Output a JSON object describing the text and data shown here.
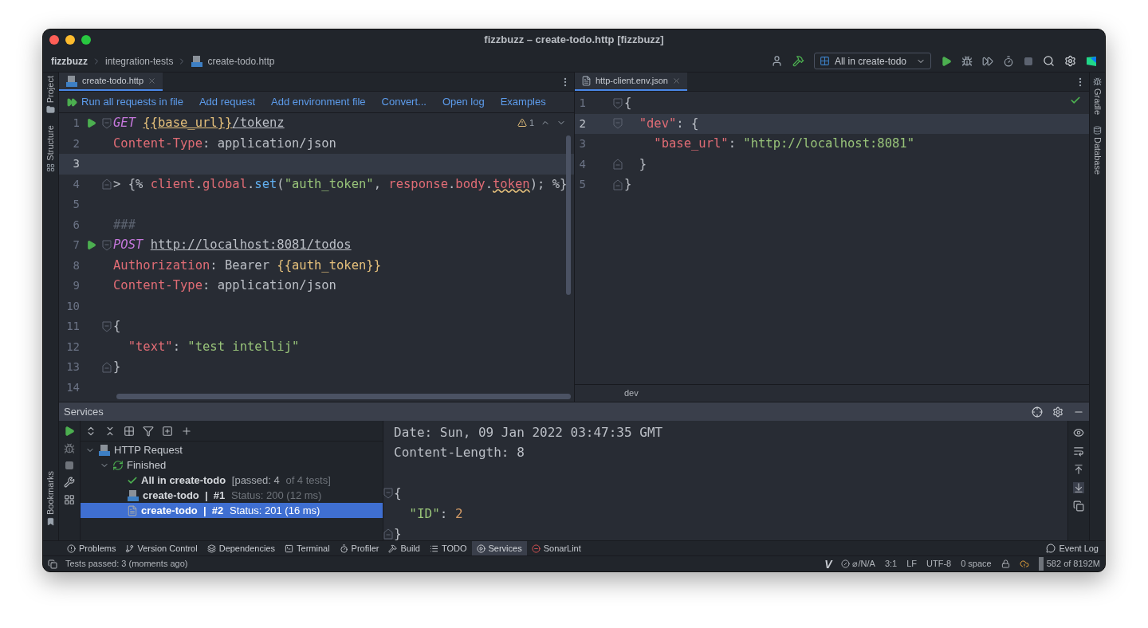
{
  "window": {
    "title": "fizzbuzz – create-todo.http [fizzbuzz]"
  },
  "breadcrumbs": [
    "fizzbuzz",
    "integration-tests",
    "create-todo.http"
  ],
  "run_config": "All in create-todo",
  "left_stripe": {
    "top": [
      "Project",
      "Structure"
    ],
    "bottom": [
      "Bookmarks"
    ]
  },
  "right_stripe": [
    "Gradle",
    "Database"
  ],
  "left_editor": {
    "tab": {
      "label": "create-todo.http",
      "selected": true
    },
    "actions": [
      "Run all requests in file",
      "Add request",
      "Add environment file",
      "Convert...",
      "Open log",
      "Examples"
    ],
    "warnings": "1",
    "lines": [
      {
        "n": "1",
        "run": true,
        "fold_open": true,
        "fold_close": false,
        "current": false,
        "tokens": [
          {
            "kind": "method",
            "text": "GET "
          },
          {
            "kind": "varurl",
            "text": "{{base_url}}"
          },
          {
            "kind": "url",
            "text": "/tokenz"
          }
        ]
      },
      {
        "n": "2",
        "run": false,
        "fold_open": false,
        "fold_close": false,
        "current": false,
        "tokens": [
          {
            "kind": "header",
            "text": "Content-Type"
          },
          {
            "kind": "plain",
            "text": ": application/json"
          }
        ]
      },
      {
        "n": "3",
        "run": false,
        "fold_open": false,
        "fold_close": false,
        "current": true
      },
      {
        "n": "4",
        "run": false,
        "fold_open": false,
        "fold_close": true,
        "current": false,
        "tokens": [
          {
            "kind": "plain",
            "text": "> {% "
          },
          {
            "kind": "ident",
            "text": "client"
          },
          {
            "kind": "plain",
            "text": "."
          },
          {
            "kind": "ident",
            "text": "global"
          },
          {
            "kind": "plain",
            "text": "."
          },
          {
            "kind": "fn",
            "text": "set"
          },
          {
            "kind": "plain",
            "text": "("
          },
          {
            "kind": "string",
            "text": "\"auth_token\""
          },
          {
            "kind": "plain",
            "text": ", "
          },
          {
            "kind": "ident",
            "text": "response"
          },
          {
            "kind": "plain",
            "text": "."
          },
          {
            "kind": "ident",
            "text": "body"
          },
          {
            "kind": "plain",
            "text": "."
          },
          {
            "kind": "warn",
            "text": "token"
          },
          {
            "kind": "plain",
            "text": "); %}"
          }
        ]
      },
      {
        "n": "5",
        "run": false,
        "fold_open": false,
        "fold_close": false,
        "current": false
      },
      {
        "n": "6",
        "run": false,
        "fold_open": false,
        "fold_close": false,
        "current": false,
        "tokens": [
          {
            "kind": "comment",
            "text": "###"
          }
        ]
      },
      {
        "n": "7",
        "run": true,
        "fold_open": true,
        "fold_close": false,
        "current": false,
        "tokens": [
          {
            "kind": "method",
            "text": "POST "
          },
          {
            "kind": "url",
            "text": "http://localhost:8081/todos"
          }
        ]
      },
      {
        "n": "8",
        "run": false,
        "fold_open": false,
        "fold_close": false,
        "current": false,
        "tokens": [
          {
            "kind": "header",
            "text": "Authorization"
          },
          {
            "kind": "plain",
            "text": ": Bearer "
          },
          {
            "kind": "var",
            "text": "{{auth_token}}"
          }
        ]
      },
      {
        "n": "9",
        "run": false,
        "fold_open": false,
        "fold_close": false,
        "current": false,
        "tokens": [
          {
            "kind": "header",
            "text": "Content-Type"
          },
          {
            "kind": "plain",
            "text": ": application/json"
          }
        ]
      },
      {
        "n": "10",
        "run": false,
        "fold_open": false,
        "fold_close": false,
        "current": false
      },
      {
        "n": "11",
        "run": false,
        "fold_open": true,
        "fold_close": false,
        "current": false,
        "tokens": [
          {
            "kind": "plain",
            "text": "{"
          }
        ]
      },
      {
        "n": "12",
        "run": false,
        "fold_open": false,
        "fold_close": false,
        "current": false,
        "tokens": [
          {
            "kind": "key",
            "text": "  \"text\""
          },
          {
            "kind": "plain",
            "text": ": "
          },
          {
            "kind": "string",
            "text": "\"test intellij\""
          }
        ]
      },
      {
        "n": "13",
        "run": false,
        "fold_open": false,
        "fold_close": true,
        "current": false,
        "tokens": [
          {
            "kind": "plain",
            "text": "}"
          }
        ]
      },
      {
        "n": "14",
        "run": false,
        "fold_open": false,
        "fold_close": false,
        "current": false
      }
    ]
  },
  "right_editor": {
    "tab": {
      "label": "http-client.env.json",
      "selected": true
    },
    "lines": [
      {
        "n": "1",
        "fold_open": true,
        "fold_close": false,
        "current": false,
        "tokens": [
          {
            "kind": "plain",
            "text": "{"
          }
        ]
      },
      {
        "n": "2",
        "fold_open": true,
        "fold_close": false,
        "current": true,
        "tokens": [
          {
            "kind": "key",
            "text": "  \"dev\""
          },
          {
            "kind": "plain",
            "text": ": {"
          }
        ]
      },
      {
        "n": "3",
        "fold_open": false,
        "fold_close": false,
        "current": false,
        "tokens": [
          {
            "kind": "key",
            "text": "    \"base_url\""
          },
          {
            "kind": "plain",
            "text": ": "
          },
          {
            "kind": "string",
            "text": "\"http://localhost:8081\""
          }
        ]
      },
      {
        "n": "4",
        "fold_open": false,
        "fold_close": true,
        "current": false,
        "tokens": [
          {
            "kind": "plain",
            "text": "  }"
          }
        ]
      },
      {
        "n": "5",
        "fold_open": false,
        "fold_close": true,
        "current": false,
        "tokens": [
          {
            "kind": "plain",
            "text": "}"
          }
        ]
      }
    ],
    "breadcrumb": "dev"
  },
  "services": {
    "title": "Services",
    "tree": [
      {
        "label": "HTTP Request",
        "kind": "api",
        "expanded": true,
        "selected": false,
        "children": [
          {
            "label": "Finished",
            "kind": "rerun",
            "expanded": true,
            "selected": false,
            "children": [
              {
                "parts": [
                  {
                    "kind": "bold",
                    "text": "All in create-todo"
                  },
                  {
                    "kind": "normal",
                    "text": " [passed: 4"
                  },
                  {
                    "kind": "dim",
                    "text": " of 4 tests]"
                  }
                ],
                "kind": "check",
                "selected": false
              },
              {
                "parts": [
                  {
                    "kind": "bold",
                    "text": "create-todo  |  #1"
                  },
                  {
                    "kind": "dim",
                    "text": " Status: 200 (12 ms)"
                  }
                ],
                "kind": "api",
                "selected": false
              },
              {
                "parts": [
                  {
                    "kind": "bold",
                    "text": "create-todo  |  #2"
                  },
                  {
                    "kind": "normal",
                    "text": " Status: 201 (16 ms)"
                  }
                ],
                "kind": "file",
                "selected": true
              }
            ]
          }
        ]
      }
    ],
    "output": [
      {
        "fold_open": false,
        "fold_close": false,
        "tokens": [
          {
            "kind": "plain",
            "text": "Date: Sun, 09 Jan 2022 03:47:35 GMT"
          }
        ]
      },
      {
        "fold_open": false,
        "fold_close": false,
        "tokens": [
          {
            "kind": "plain",
            "text": "Content-Length: 8"
          }
        ]
      },
      {
        "fold_open": false,
        "fold_close": false
      },
      {
        "fold_open": true,
        "fold_close": false,
        "tokens": [
          {
            "kind": "plain",
            "text": "{"
          }
        ]
      },
      {
        "fold_open": false,
        "fold_close": false,
        "tokens": [
          {
            "kind": "string",
            "text": "  \"ID\""
          },
          {
            "kind": "plain",
            "text": ": "
          },
          {
            "kind": "number",
            "text": "2"
          }
        ]
      },
      {
        "fold_open": false,
        "fold_close": true,
        "tokens": [
          {
            "kind": "plain",
            "text": "}"
          }
        ]
      }
    ]
  },
  "tool_windows": [
    {
      "label": "Problems",
      "selected": false
    },
    {
      "label": "Version Control",
      "selected": false
    },
    {
      "label": "Dependencies",
      "selected": false
    },
    {
      "label": "Terminal",
      "selected": false
    },
    {
      "label": "Profiler",
      "selected": false
    },
    {
      "label": "Build",
      "selected": false
    },
    {
      "label": "TODO",
      "selected": false
    },
    {
      "label": "Services",
      "selected": true
    },
    {
      "label": "SonarLint",
      "selected": false
    }
  ],
  "event_log": "Event Log",
  "status_bar": {
    "message": "Tests passed: 3 (moments ago)",
    "vim": "V",
    "items": [
      "⌀/N/A",
      "3:1",
      "LF",
      "UTF-8",
      "0 space"
    ],
    "memory": "582 of 8192M"
  }
}
